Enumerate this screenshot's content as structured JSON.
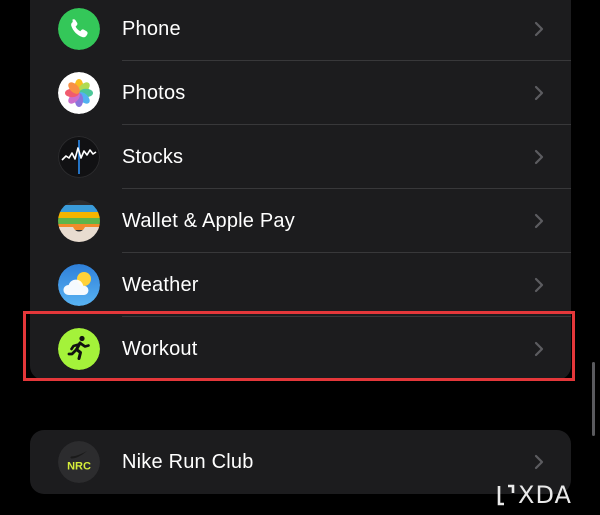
{
  "apps_group": {
    "items": [
      {
        "label": "Phone",
        "icon": "phone-icon"
      },
      {
        "label": "Photos",
        "icon": "photos-icon"
      },
      {
        "label": "Stocks",
        "icon": "stocks-icon"
      },
      {
        "label": "Wallet & Apple Pay",
        "icon": "wallet-icon"
      },
      {
        "label": "Weather",
        "icon": "weather-icon"
      },
      {
        "label": "Workout",
        "icon": "workout-icon",
        "highlighted": true
      }
    ]
  },
  "third_party_group": {
    "items": [
      {
        "label": "Nike Run Club",
        "icon": "nike-run-club-icon"
      }
    ]
  },
  "icons": {
    "nike_run_club_text": "NRC"
  },
  "watermark": {
    "text": "XDA"
  },
  "colors": {
    "background": "#000000",
    "group_background": "#1c1c1e",
    "highlight_border": "#e4373a",
    "label_text": "#ffffff",
    "chevron": "#5c5c60"
  }
}
